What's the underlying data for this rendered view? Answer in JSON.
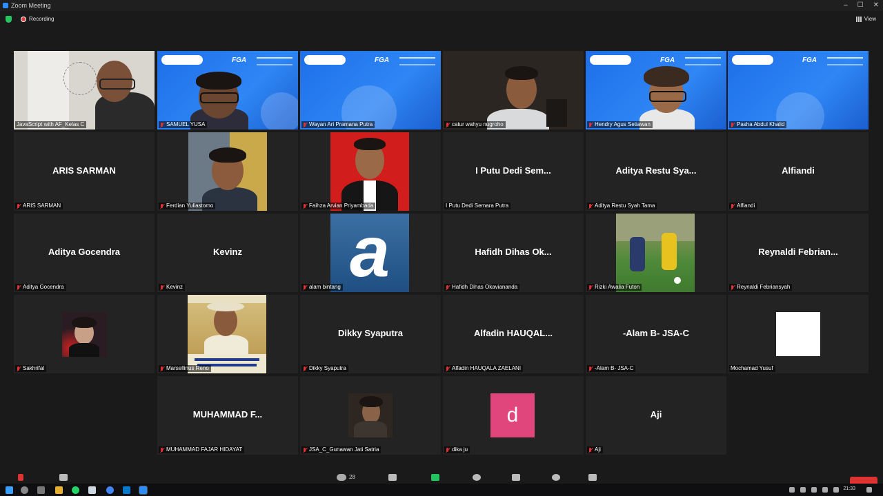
{
  "window": {
    "title": "Zoom Meeting",
    "controls": [
      "–",
      "☐",
      "✕"
    ]
  },
  "topbar": {
    "recording": "Recording",
    "view": "View"
  },
  "participants": {
    "p1": "JavaScript with AF_Kelas C",
    "p2": "SAMUEL YUSA",
    "p3": "Wayan Ari Pramana Putra",
    "p4": "catur wahyu nugroho",
    "p5": "Hendry Agus Setiawan",
    "p6": "Pasha Abdul Khalid",
    "p7_big": "ARIS SARMAN",
    "p7": "ARIS SARMAN",
    "p8": "Ferdian Yuliastomo",
    "p9": "Faihza Arvian Priyambada",
    "p10_big": "I Putu Dedi Sem...",
    "p10": "I Putu Dedi Semara Putra",
    "p11_big": "Aditya Restu Sya...",
    "p11": "Aditya Restu Syah Tama",
    "p12_big": "Alfiandi",
    "p12": "Alfiandi",
    "p13_big": "Aditya Gocendra",
    "p13": "Aditya Gocendra",
    "p14_big": "Kevinz",
    "p14": "Kevinz",
    "p15": "alam bintang",
    "p16_big": "Hafidh Dihas Ok...",
    "p16": "Hafidh Dihas Okaviananda",
    "p17": "Rizki Awalia Futon",
    "p18_big": "Reynaldi Febrian...",
    "p18": "Reynaldi Febriansyah",
    "p19": "Sakhrifal",
    "p20": "Marsellinus Reno",
    "p21_big": "Dikky Syaputra",
    "p21": "Dikky Syaputra",
    "p22_big": "Alfadin HAUQAL...",
    "p22": "Alfadin HAUQALA ZAELANI",
    "p23_big": "-Alam B- JSA-C",
    "p23": "-Alam B- JSA-C",
    "p24": "Mochamad Yusuf",
    "p25_big": "MUHAMMAD F...",
    "p25": "MUHAMMAD FAJAR HIDAYAT",
    "p26": "JSA_C_Gunawan Jati Satria",
    "p27_letter": "d",
    "p27": "dika ju",
    "p28_big": "Aji",
    "p28": "Aji"
  },
  "alam_avatar_letter": "a",
  "banner_text": "FGA",
  "toolbar": {
    "participants_count": "28"
  },
  "taskbar": {
    "time": "21:33"
  },
  "colors": {
    "active_border": "#e5ea62",
    "zoom_blue": "#2d8cff",
    "pink_avatar": "#e0457b"
  }
}
